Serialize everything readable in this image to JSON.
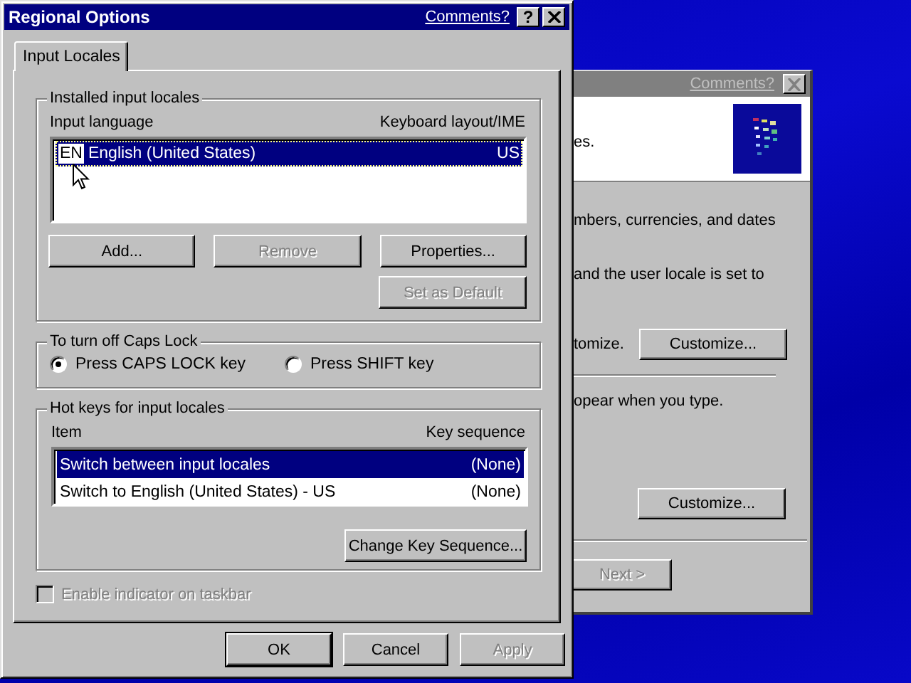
{
  "background_window": {
    "comments_link": "Comments?",
    "header_text": "es.",
    "content": [
      {
        "kind": "text",
        "text": "mbers, currencies, and dates"
      },
      {
        "kind": "text",
        "text": "and the user locale is set to"
      },
      {
        "kind": "text_button",
        "text": "tomize.",
        "button": "Customize..."
      },
      {
        "kind": "separator"
      },
      {
        "kind": "text",
        "text": "opear when you type."
      },
      {
        "kind": "button",
        "button": "Customize..."
      }
    ],
    "next_button": {
      "label": "Next >",
      "disabled": true
    }
  },
  "dialog": {
    "title": "Regional Options",
    "comments_link": "Comments?",
    "help_button": "?",
    "tabs": [
      {
        "label": "Input Locales",
        "selected": true
      }
    ],
    "installed_group": {
      "title": "Installed input locales",
      "columns": [
        "Input language",
        "Keyboard layout/IME"
      ],
      "rows": [
        {
          "badge": "EN",
          "language": "English (United States)",
          "layout": "US",
          "selected": true
        }
      ],
      "buttons": [
        {
          "label": "Add...",
          "disabled": false
        },
        {
          "label": "Remove",
          "disabled": true
        },
        {
          "label": "Properties...",
          "disabled": false
        },
        {
          "label": "Set as Default",
          "disabled": true
        }
      ]
    },
    "caps_lock_group": {
      "title": "To turn off Caps Lock",
      "options": [
        {
          "label": "Press CAPS LOCK key",
          "selected": true
        },
        {
          "label": "Press SHIFT key",
          "selected": false
        }
      ]
    },
    "hotkeys_group": {
      "title": "Hot keys for input locales",
      "columns": [
        "Item",
        "Key sequence"
      ],
      "rows": [
        {
          "item": "Switch between input locales",
          "sequence": "(None)",
          "selected": true
        },
        {
          "item": "Switch to English (United States) - US",
          "sequence": "(None)",
          "selected": false
        }
      ],
      "button": {
        "label": "Change Key Sequence...",
        "disabled": false
      }
    },
    "taskbar_indicator": {
      "label": "Enable indicator on taskbar",
      "checked": false,
      "disabled": true
    },
    "buttons": [
      {
        "label": "OK",
        "disabled": false,
        "default": true
      },
      {
        "label": "Cancel",
        "disabled": false,
        "default": false
      },
      {
        "label": "Apply",
        "disabled": true,
        "default": false
      }
    ]
  }
}
